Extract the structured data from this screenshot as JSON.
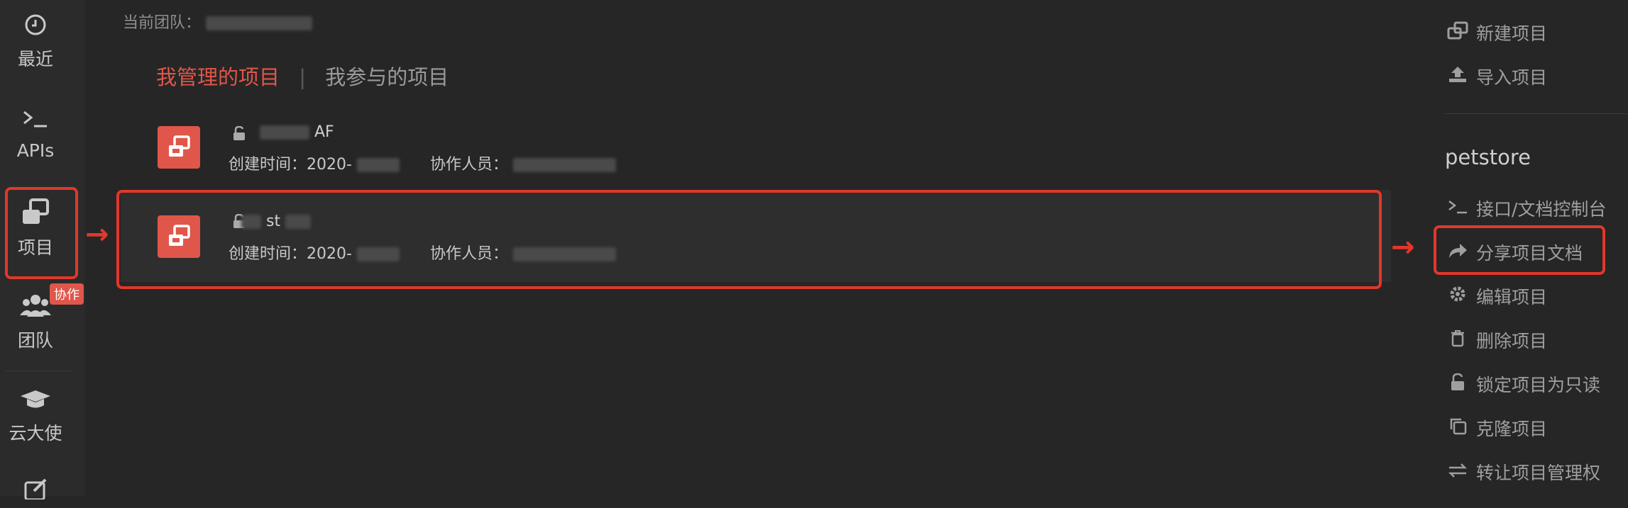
{
  "sidebar": {
    "items": [
      {
        "label": "最近",
        "icon": "clock-icon"
      },
      {
        "label": "APIs",
        "icon": "terminal-icon"
      },
      {
        "label": "项目",
        "icon": "project-icon"
      },
      {
        "label": "团队",
        "icon": "team-icon"
      },
      {
        "label": "云大使",
        "icon": "graduation-cap-icon"
      }
    ],
    "team_badge": "协作"
  },
  "team_line": {
    "label": "当前团队："
  },
  "tabs": {
    "active": "我管理的项目",
    "separator": "|",
    "inactive": "我参与的项目"
  },
  "projects": [
    {
      "name": "AF",
      "created_label": "创建时间：",
      "created_value": "2020-",
      "members_label": "协作人员："
    },
    {
      "name": "st",
      "created_label": "创建时间：",
      "created_value": "2020-",
      "members_label": "协作人员："
    }
  ],
  "right_panel": {
    "actions_top": [
      {
        "label": "新建项目",
        "icon": "new-project-icon"
      },
      {
        "label": "导入项目",
        "icon": "import-icon"
      }
    ],
    "project_title": "petstore",
    "actions": [
      {
        "label": "接口/文档控制台",
        "icon": "terminal-icon"
      },
      {
        "label": "分享项目文档",
        "icon": "share-icon"
      },
      {
        "label": "编辑项目",
        "icon": "gear-icon"
      },
      {
        "label": "删除项目",
        "icon": "trash-icon"
      },
      {
        "label": "锁定项目为只读",
        "icon": "lock-icon"
      },
      {
        "label": "克隆项目",
        "icon": "clone-icon"
      },
      {
        "label": "转让项目管理权",
        "icon": "transfer-icon"
      }
    ]
  },
  "colors": {
    "accent": "#e0564a",
    "highlight_box": "#e2372b",
    "background": "#262626"
  }
}
